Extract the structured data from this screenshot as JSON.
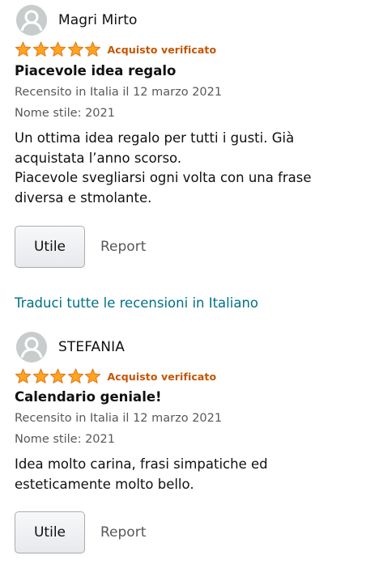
{
  "reviews": [
    {
      "author": "Magri Mirto",
      "rating": 5,
      "verified_label": "Acquisto verificato",
      "title": "Piacevole idea regalo",
      "date": "Recensito in Italia il 12 marzo 2021",
      "style": "Nome stile: 2021",
      "body_lines": [
        "Un ottima idea regalo per tutti i gusti. Già",
        "acquistata l’anno scorso.",
        "Piacevole svegliarsi ogni volta con una frase",
        "diversa e stmolante."
      ],
      "helpful_label": "Utile",
      "report_label": "Report"
    },
    {
      "author": "STEFANIA",
      "rating": 5,
      "verified_label": "Acquisto verificato",
      "title": "Calendario geniale!",
      "date": "Recensito in Italia il 12 marzo 2021",
      "style": "Nome stile: 2021",
      "body_lines": [
        "Idea molto carina, frasi simpatiche ed",
        "esteticamente molto bello."
      ],
      "helpful_label": "Utile",
      "report_label": "Report"
    }
  ],
  "translate_link": "Traduci tutte le recensioni in Italiano",
  "colors": {
    "star": "#ffa41c",
    "star_stroke": "#de7921",
    "verified": "#c45500",
    "link": "#007185",
    "muted": "#565959"
  },
  "icons": {
    "avatar": "user-avatar-icon",
    "star": "star-icon"
  }
}
